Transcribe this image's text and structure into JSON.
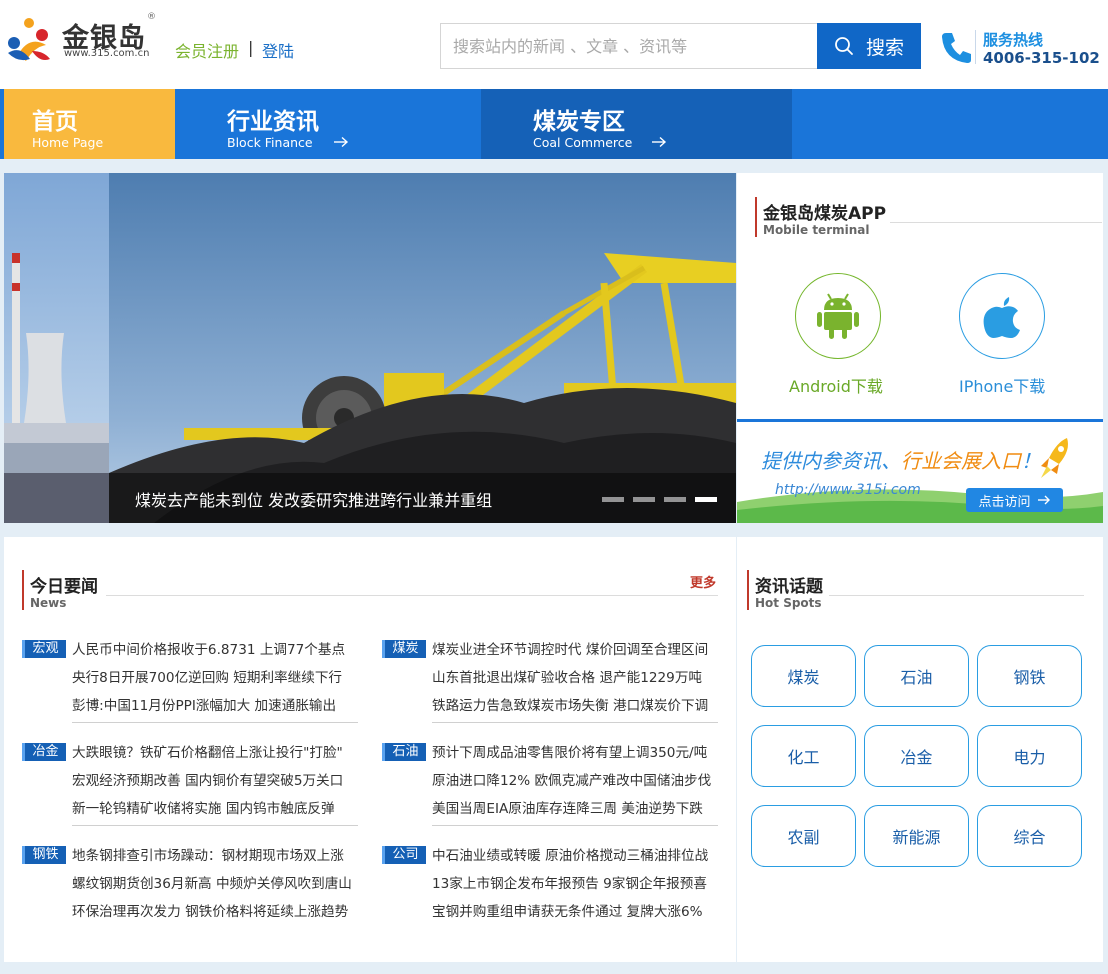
{
  "header": {
    "logo_name": "金银岛",
    "logo_reg": "®",
    "logo_url": "www.315.com.cn",
    "register": "会员注册",
    "separator": "|",
    "login": "登陆",
    "search_placeholder": "搜索站内的新闻 、文章 、资讯等",
    "search_button": "搜索",
    "hotline_label": "服务热线",
    "hotline_number": "4006-315-102"
  },
  "nav": {
    "items": [
      {
        "cn": "首页",
        "en": "Home Page"
      },
      {
        "cn": "行业资讯",
        "en": "Block Finance"
      },
      {
        "cn": "煤炭专区",
        "en": "Coal Commerce"
      }
    ]
  },
  "banner": {
    "caption": "煤炭去产能未到位 发改委研究推进跨行业兼并重组",
    "slides": 4,
    "active_slide": 4
  },
  "app": {
    "title": "金银岛煤炭APP",
    "subtitle": "Mobile terminal",
    "android_label": "Android下载",
    "iphone_label": "IPhone下载"
  },
  "ad": {
    "title_part1": "提供内参资讯、",
    "title_part2": "行业会展入口",
    "title_part3": "！",
    "url": "http://www.315i.com",
    "button": "点击访问"
  },
  "news": {
    "title": "今日要闻",
    "subtitle": "News",
    "more": "更多",
    "blocks": [
      {
        "tag": "宏观",
        "lines": [
          "人民币中间价格报收于6.8731 上调77个基点",
          "央行8日开展700亿逆回购 短期利率继续下行",
          "彭博:中国11月份PPI涨幅加大 加速通胀输出"
        ]
      },
      {
        "tag": "煤炭",
        "lines": [
          "煤炭业进全环节调控时代 煤价回调至合理区间",
          "山东首批退出煤矿验收合格 退产能1229万吨",
          "铁路运力告急致煤炭市场失衡 港口煤炭价下调"
        ]
      },
      {
        "tag": "冶金",
        "lines": [
          "大跌眼镜？铁矿石价格翻倍上涨让投行\"打脸\"",
          "宏观经济预期改善 国内铜价有望突破5万关口",
          "新一轮钨精矿收储将实施 国内钨市触底反弹"
        ]
      },
      {
        "tag": "石油",
        "lines": [
          "预计下周成品油零售限价将有望上调350元/吨",
          "原油进口降12% 欧佩克减产难改中国储油步伐",
          "美国当周EIA原油库存连降三周 美油逆势下跌"
        ]
      },
      {
        "tag": "钢铁",
        "lines": [
          "地条钢排查引市场躁动：钢材期现市场双上涨",
          "螺纹钢期货创36月新高 中频炉关停风吹到唐山",
          "环保治理再次发力 钢铁价格料将延续上涨趋势"
        ]
      },
      {
        "tag": "公司",
        "lines": [
          "中石油业绩或转暖 原油价格搅动三桶油排位战",
          "13家上市钢企发布年报预告 9家钢企年报预喜",
          "宝钢并购重组申请获无条件通过 复牌大涨6%"
        ]
      }
    ]
  },
  "topics": {
    "title": "资讯话题",
    "subtitle": "Hot Spots",
    "items": [
      "煤炭",
      "石油",
      "钢铁",
      "化工",
      "冶金",
      "电力",
      "农副",
      "新能源",
      "综合"
    ]
  }
}
